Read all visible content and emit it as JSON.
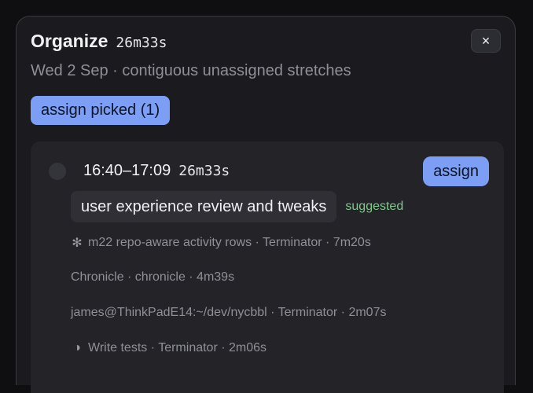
{
  "header": {
    "title": "Organize",
    "duration": "26m33s",
    "subtitle": "Wed 2 Sep · contiguous unassigned stretches",
    "close_label": "×"
  },
  "toolbar": {
    "assign_picked_label": "assign picked (1)"
  },
  "stretch": {
    "time_range": "16:40–17:09",
    "duration": "26m33s",
    "assign_label": "assign",
    "suggestion": "user experience review and tweaks",
    "suggestion_tag": "suggested",
    "activities": [
      {
        "icon": "asterisk-icon",
        "glyph": "✻",
        "text": "m22 repo-aware activity rows · Terminator · 7m20s"
      },
      {
        "icon": "",
        "glyph": "",
        "text": "Chronicle · chronicle · 4m39s"
      },
      {
        "icon": "",
        "glyph": "",
        "text": "james@ThinkPadE14:~/dev/nycbbl · Terminator · 2m07s"
      },
      {
        "icon": "half-circle-icon",
        "glyph": "◑",
        "text": "Write tests · Terminator · 2m06s"
      }
    ]
  },
  "colors": {
    "accent": "#7c9ef5",
    "suggested": "#7fc98a",
    "panel": "#1b1b1f",
    "card": "#232328"
  }
}
